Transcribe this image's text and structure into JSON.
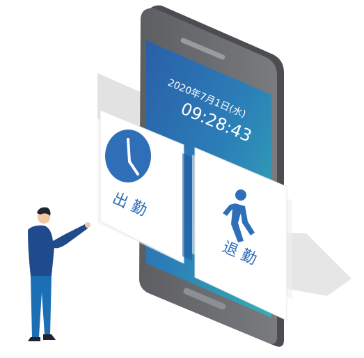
{
  "phone": {
    "date": "2020年7月1日(水)",
    "time": "09:28:43"
  },
  "cards": {
    "clock_in": {
      "label": "出 勤",
      "icon": "clock-icon"
    },
    "clock_out": {
      "label": "退 勤",
      "icon": "walking-person-icon"
    }
  },
  "colors": {
    "phone_frame": "#6e6f73",
    "phone_frame_dark": "#505155",
    "screen_top": "#2c6fb3",
    "screen_bottom": "#30a3b4",
    "accent_blue": "#2f6fb8",
    "card_panel": "#ffffff",
    "shadow": "#d9d9d9",
    "person_shirt": "#1f4a8c",
    "person_pants": "#1c6fb5"
  }
}
